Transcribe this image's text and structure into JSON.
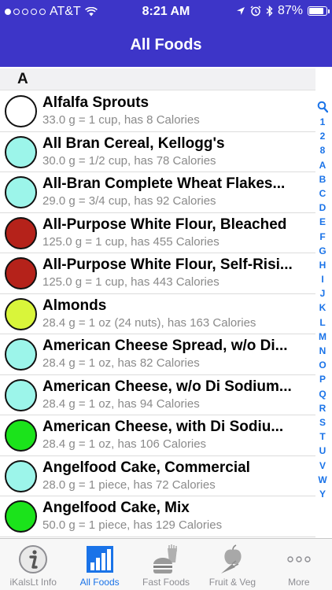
{
  "status_bar": {
    "carrier": "AT&T",
    "time": "8:21 AM",
    "battery": "87%",
    "battery_level": 0.87,
    "signal_bars_filled": 1
  },
  "nav": {
    "title": "All Foods"
  },
  "section": {
    "letter": "A"
  },
  "foods": [
    {
      "name": "Alfalfa Sprouts",
      "detail": "33.0 g = 1 cup, has 8 Calories",
      "color": "#ffffff"
    },
    {
      "name": "All Bran Cereal, Kellogg's",
      "detail": "30.0 g = 1/2 cup, has 78 Calories",
      "color": "#9cf5ea"
    },
    {
      "name": "All-Bran Complete Wheat Flakes...",
      "detail": "29.0 g = 3/4 cup, has 92 Calories",
      "color": "#9cf5ea"
    },
    {
      "name": "All-Purpose White Flour, Bleached",
      "detail": "125.0 g = 1 cup, has 455 Calories",
      "color": "#b5221a"
    },
    {
      "name": "All-Purpose White Flour, Self-Risi...",
      "detail": "125.0 g = 1 cup, has 443 Calories",
      "color": "#b5221a"
    },
    {
      "name": "Almonds",
      "detail": "28.4 g = 1 oz (24 nuts), has 163 Calories",
      "color": "#d9f53a"
    },
    {
      "name": "American Cheese Spread, w/o Di...",
      "detail": "28.4 g = 1 oz, has 82 Calories",
      "color": "#9cf5ea"
    },
    {
      "name": "American Cheese, w/o Di Sodium...",
      "detail": "28.4 g = 1 oz, has 94 Calories",
      "color": "#9cf5ea"
    },
    {
      "name": "American Cheese, with Di Sodiu...",
      "detail": "28.4 g = 1 oz, has 106 Calories",
      "color": "#1be31b"
    },
    {
      "name": "Angelfood Cake, Commercial",
      "detail": "28.0 g = 1 piece, has 72 Calories",
      "color": "#9cf5ea"
    },
    {
      "name": "Angelfood Cake, Mix",
      "detail": "50.0 g = 1 piece, has 129 Calories",
      "color": "#1be31b"
    }
  ],
  "index_letters": [
    "1",
    "2",
    "8",
    "A",
    "B",
    "C",
    "D",
    "E",
    "F",
    "G",
    "H",
    "I",
    "J",
    "K",
    "L",
    "M",
    "N",
    "O",
    "P",
    "Q",
    "R",
    "S",
    "T",
    "U",
    "V",
    "W",
    "Y"
  ],
  "tabs": [
    {
      "label": "iKalsLt Info",
      "icon": "info-icon"
    },
    {
      "label": "All Foods",
      "icon": "bar-chart-icon"
    },
    {
      "label": "Fast Foods",
      "icon": "fast-food-icon"
    },
    {
      "label": "Fruit & Veg",
      "icon": "fruit-veg-icon"
    },
    {
      "label": "More",
      "icon": "more-icon"
    }
  ],
  "active_tab": 1,
  "colors": {
    "nav_bar": "#3d35c8",
    "accent": "#1a73e8"
  }
}
